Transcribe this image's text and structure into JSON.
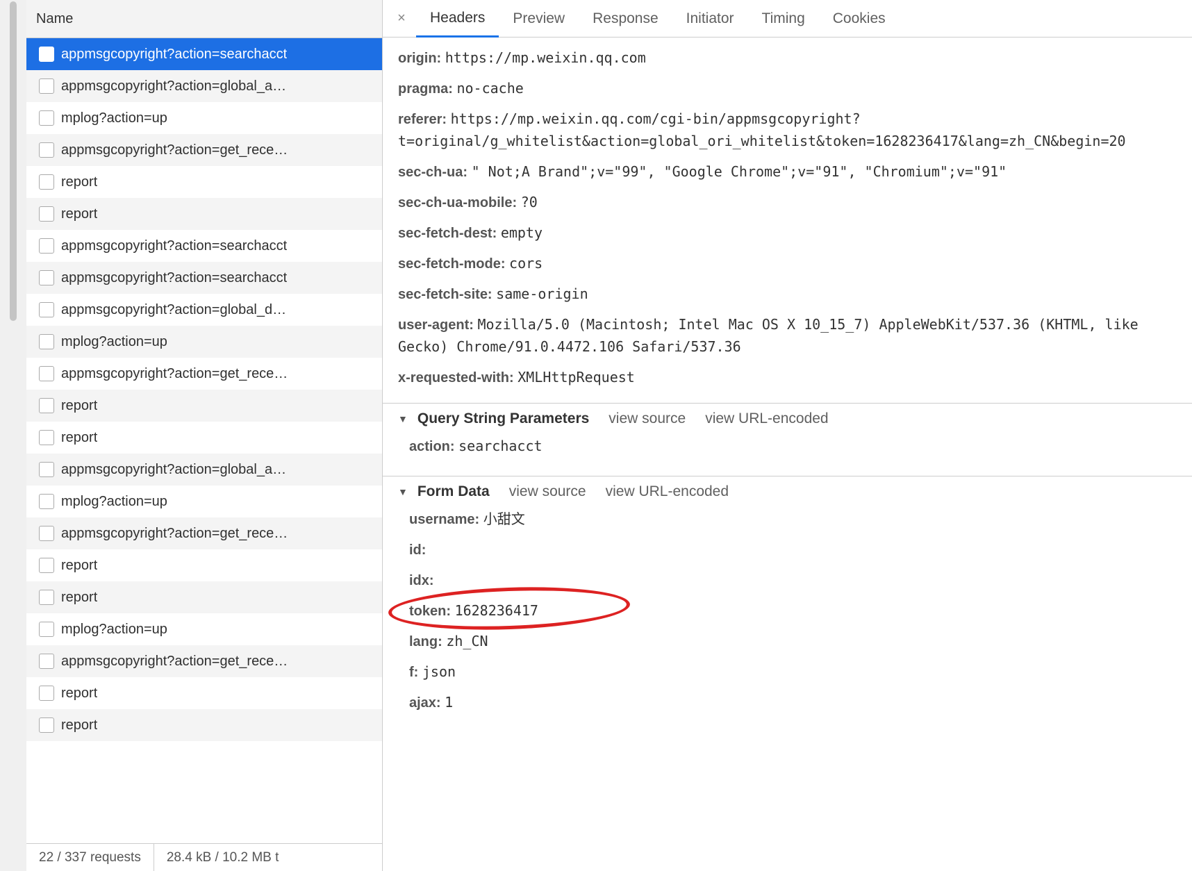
{
  "sidebar": {
    "header": "Name",
    "requests": [
      {
        "label": "appmsgcopyright?action=searchacct",
        "selected": true
      },
      {
        "label": "appmsgcopyright?action=global_a…"
      },
      {
        "label": "mplog?action=up"
      },
      {
        "label": "appmsgcopyright?action=get_rece…"
      },
      {
        "label": "report"
      },
      {
        "label": "report"
      },
      {
        "label": "appmsgcopyright?action=searchacct"
      },
      {
        "label": "appmsgcopyright?action=searchacct"
      },
      {
        "label": "appmsgcopyright?action=global_d…"
      },
      {
        "label": "mplog?action=up"
      },
      {
        "label": "appmsgcopyright?action=get_rece…"
      },
      {
        "label": "report"
      },
      {
        "label": "report"
      },
      {
        "label": "appmsgcopyright?action=global_a…"
      },
      {
        "label": "mplog?action=up"
      },
      {
        "label": "appmsgcopyright?action=get_rece…"
      },
      {
        "label": "report"
      },
      {
        "label": "report"
      },
      {
        "label": "mplog?action=up"
      },
      {
        "label": "appmsgcopyright?action=get_rece…"
      },
      {
        "label": "report"
      },
      {
        "label": "report"
      }
    ],
    "footer_left": "22 / 337 requests",
    "footer_right": "28.4 kB / 10.2 MB t"
  },
  "tabs": {
    "headers": "Headers",
    "preview": "Preview",
    "response": "Response",
    "initiator": "Initiator",
    "timing": "Timing",
    "cookies": "Cookies"
  },
  "headers": [
    {
      "k": "origin:",
      "v": "https://mp.weixin.qq.com"
    },
    {
      "k": "pragma:",
      "v": "no-cache"
    },
    {
      "k": "referer:",
      "v": "https://mp.weixin.qq.com/cgi-bin/appmsgcopyright?t=original/g_whitelist&action=global_ori_whitelist&token=1628236417&lang=zh_CN&begin=20"
    },
    {
      "k": "sec-ch-ua:",
      "v": "\" Not;A Brand\";v=\"99\", \"Google Chrome\";v=\"91\", \"Chromium\";v=\"91\""
    },
    {
      "k": "sec-ch-ua-mobile:",
      "v": "?0"
    },
    {
      "k": "sec-fetch-dest:",
      "v": "empty"
    },
    {
      "k": "sec-fetch-mode:",
      "v": "cors"
    },
    {
      "k": "sec-fetch-site:",
      "v": "same-origin"
    },
    {
      "k": "user-agent:",
      "v": "Mozilla/5.0 (Macintosh; Intel Mac OS X 10_15_7) AppleWebKit/537.36 (KHTML, like Gecko) Chrome/91.0.4472.106 Safari/537.36"
    },
    {
      "k": "x-requested-with:",
      "v": "XMLHttpRequest"
    }
  ],
  "qsp_section": "Query String Parameters",
  "view_source": "view source",
  "view_url_encoded": "view URL-encoded",
  "qsp": [
    {
      "k": "action:",
      "v": "searchacct"
    }
  ],
  "formdata_section": "Form Data",
  "formdata": [
    {
      "k": "username:",
      "v": "小甜文"
    },
    {
      "k": "id:",
      "v": ""
    },
    {
      "k": "idx:",
      "v": ""
    },
    {
      "k": "token:",
      "v": "1628236417",
      "circle": true
    },
    {
      "k": "lang:",
      "v": "zh_CN"
    },
    {
      "k": "f:",
      "v": "json"
    },
    {
      "k": "ajax:",
      "v": "1"
    }
  ]
}
